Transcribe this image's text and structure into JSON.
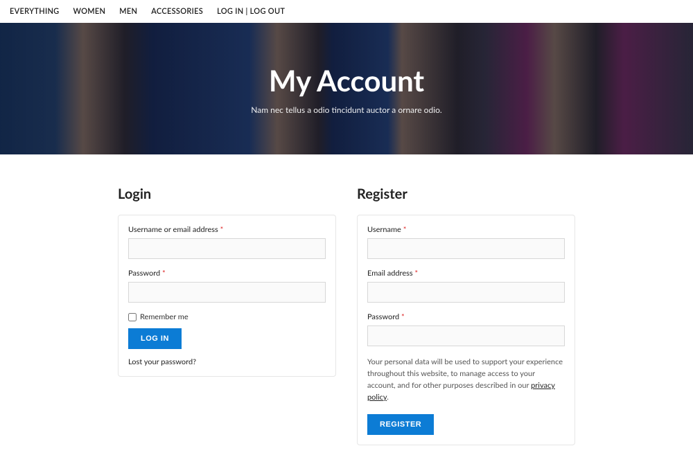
{
  "nav": {
    "everything": "EVERYTHING",
    "women": "WOMEN",
    "men": "MEN",
    "accessories": "ACCESSORIES",
    "login_logout": "LOG IN | LOG OUT"
  },
  "hero": {
    "title": "My Account",
    "subtitle": "Nam nec tellus a odio tincidunt auctor a ornare odio."
  },
  "login": {
    "heading": "Login",
    "username_label": "Username or email address ",
    "password_label": "Password ",
    "remember_label": "Remember me",
    "button": "LOG IN",
    "lost_password": "Lost your password?",
    "required": "*"
  },
  "register": {
    "heading": "Register",
    "username_label": "Username ",
    "email_label": "Email address ",
    "password_label": "Password ",
    "privacy_text": "Your personal data will be used to support your experience throughout this website, to manage access to your account, and for other purposes described in our ",
    "privacy_link": "privacy policy",
    "privacy_after": ".",
    "button": "REGISTER",
    "required": "*"
  }
}
